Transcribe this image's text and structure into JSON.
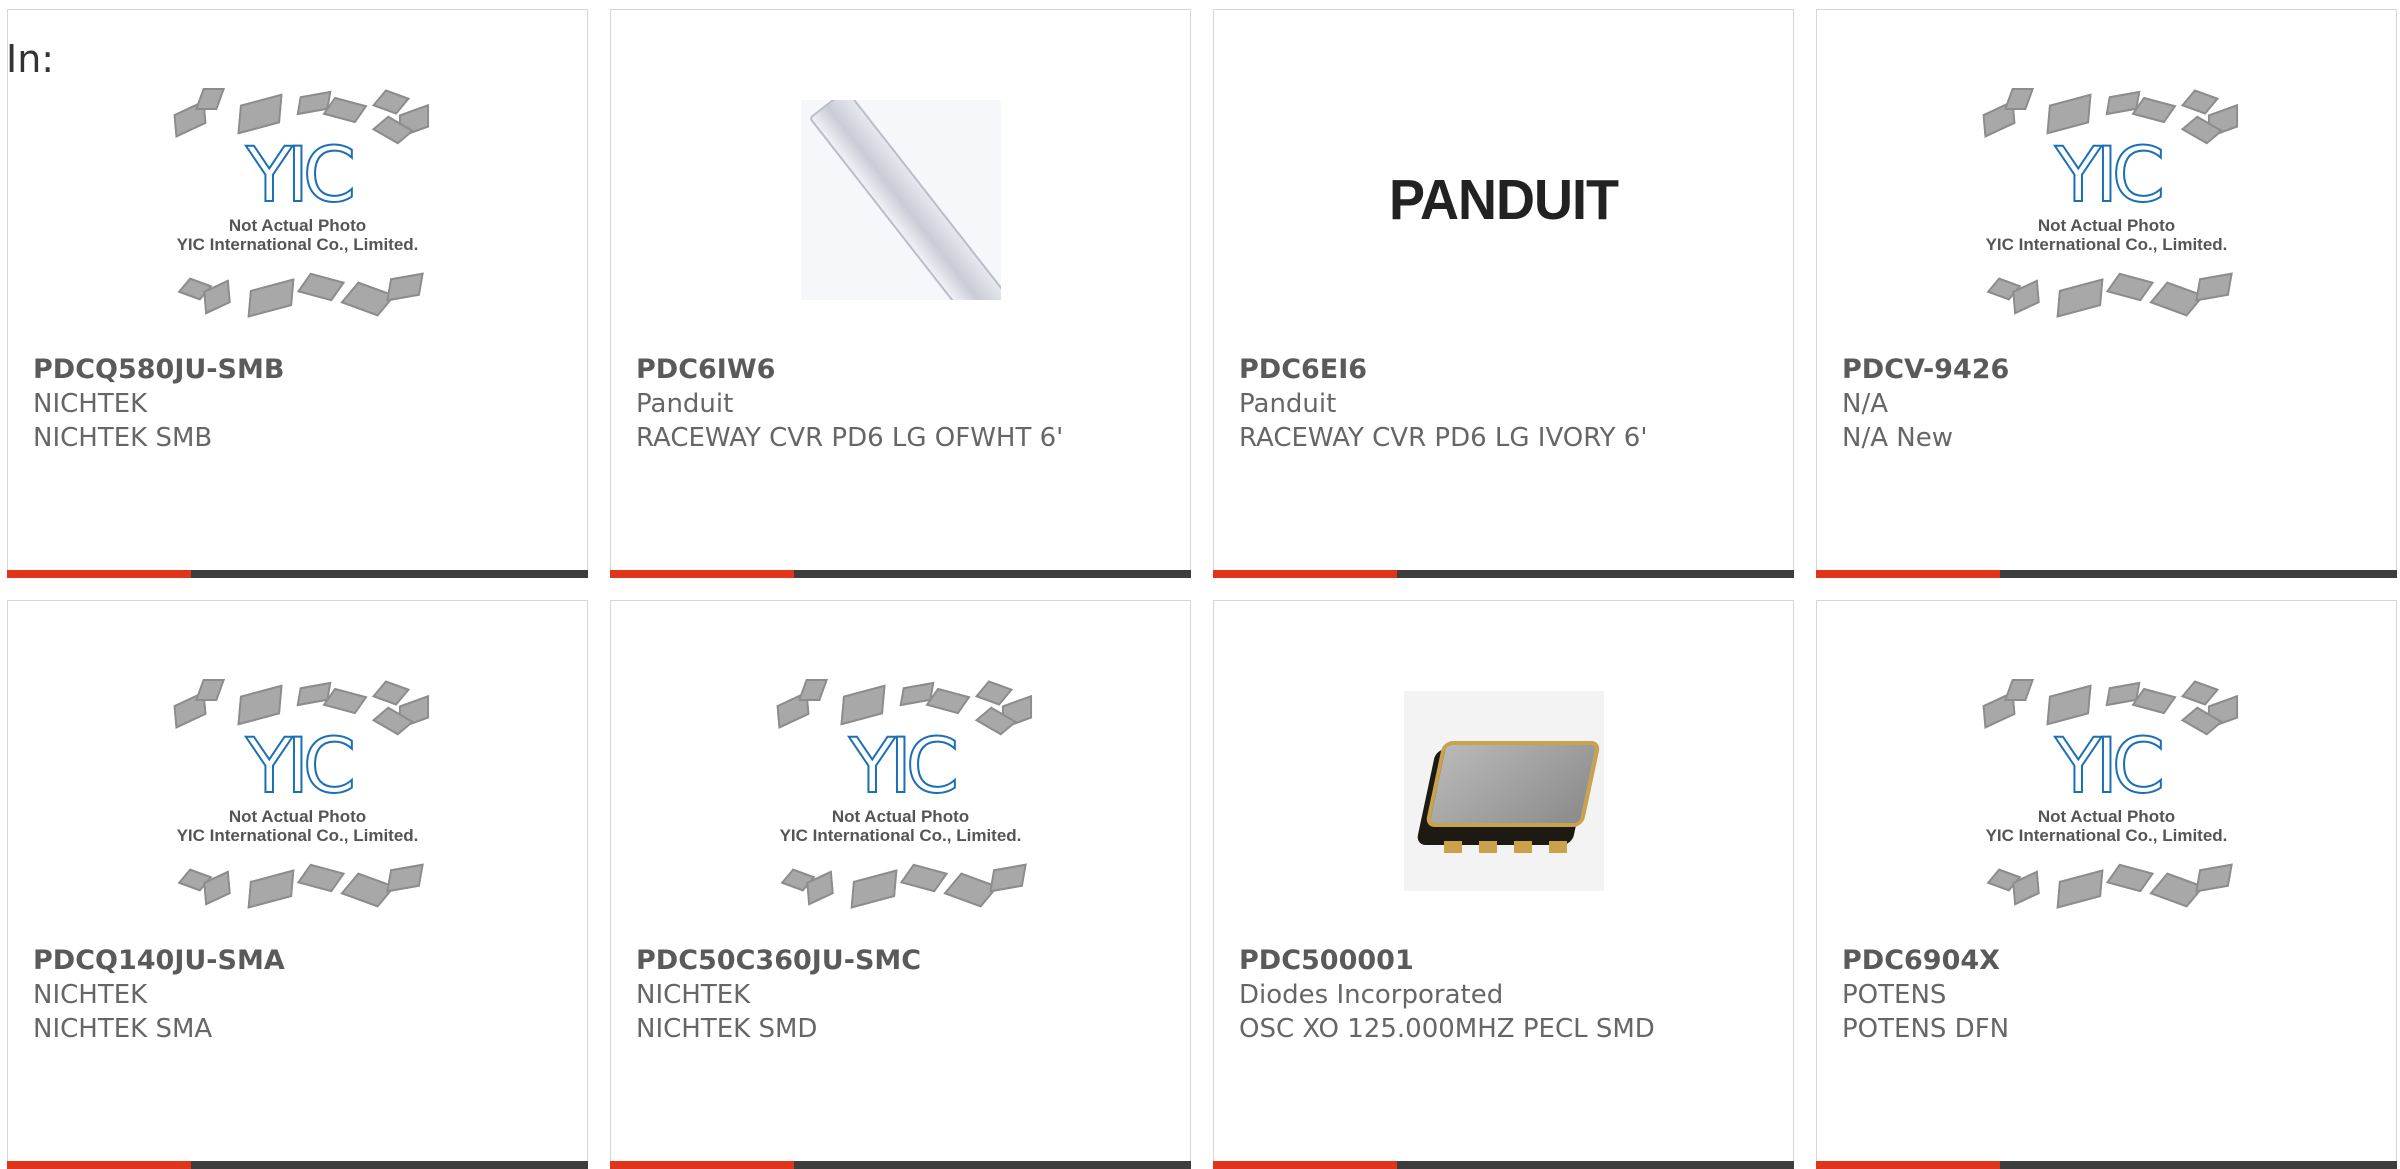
{
  "header": {
    "in_label": "In:"
  },
  "placeholder": {
    "line1": "Not Actual Photo",
    "line2": "YIC International Co., Limited.",
    "logo_text": "YIC"
  },
  "panduit_logo": "PANDUIT",
  "colors": {
    "accent": "#e0341b",
    "bar": "#3d3d3d",
    "card_border": "#d6d6d6",
    "logo_blue": "#2b8fd6"
  },
  "products": [
    {
      "part": "PDCQ580JU-SMB",
      "manufacturer": "NICHTEK",
      "description": "NICHTEK SMB",
      "image": "yic-placeholder"
    },
    {
      "part": "PDC6IW6",
      "manufacturer": "Panduit",
      "description": "RACEWAY CVR PD6 LG OFWHT 6'",
      "image": "raceway-cover-photo"
    },
    {
      "part": "PDC6EI6",
      "manufacturer": "Panduit",
      "description": "RACEWAY CVR PD6 LG IVORY 6'",
      "image": "panduit-logo"
    },
    {
      "part": "PDCV-9426",
      "manufacturer": "N/A",
      "description": "N/A New",
      "image": "yic-placeholder"
    },
    {
      "part": "PDCQ140JU-SMA",
      "manufacturer": "NICHTEK",
      "description": "NICHTEK SMA",
      "image": "yic-placeholder"
    },
    {
      "part": "PDC50C360JU-SMC",
      "manufacturer": "NICHTEK",
      "description": "NICHTEK SMD",
      "image": "yic-placeholder"
    },
    {
      "part": "PDC500001",
      "manufacturer": "Diodes Incorporated",
      "description": "OSC XO 125.000MHZ PECL SMD",
      "image": "oscillator-photo"
    },
    {
      "part": "PDC6904X",
      "manufacturer": "POTENS",
      "description": "POTENS DFN",
      "image": "yic-placeholder"
    }
  ]
}
